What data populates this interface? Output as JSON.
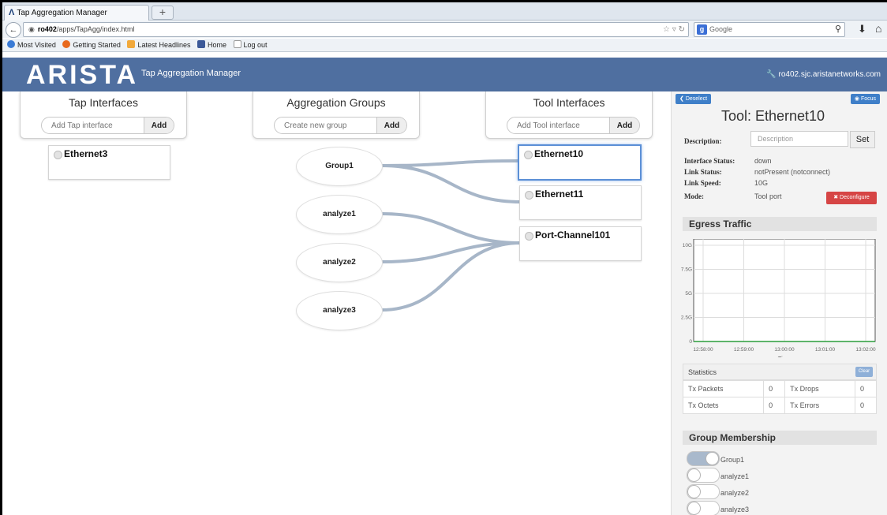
{
  "browser": {
    "tab_title": "Tap Aggregation Manager",
    "new_tab": "+",
    "url_host": "ro402",
    "url_path": "/apps/TapAgg/index.html",
    "search_placeholder": "Google",
    "bookmarks": [
      "Most Visited",
      "Getting Started",
      "Latest Headlines",
      "Home",
      "Log out"
    ]
  },
  "header": {
    "brand": "ARISTA",
    "app_title": "Tap Aggregation Manager",
    "host": "ro402.sjc.aristanetworks.com"
  },
  "columns": {
    "tap": {
      "title": "Tap Interfaces",
      "placeholder": "Add Tap interface",
      "add": "Add"
    },
    "groups": {
      "title": "Aggregation Groups",
      "placeholder": "Create new group",
      "add": "Add"
    },
    "tool": {
      "title": "Tool Interfaces",
      "placeholder": "Add Tool interface",
      "add": "Add"
    }
  },
  "tap_interfaces": [
    "Ethernet3"
  ],
  "groups": [
    "Group1",
    "analyze1",
    "analyze2",
    "analyze3"
  ],
  "tool_interfaces": [
    "Ethernet10",
    "Ethernet11",
    "Port-Channel101"
  ],
  "connections": [
    [
      "Group1",
      "Ethernet10"
    ],
    [
      "Group1",
      "Ethernet11"
    ],
    [
      "analyze1",
      "Port-Channel101"
    ],
    [
      "analyze2",
      "Port-Channel101"
    ],
    [
      "analyze3",
      "Port-Channel101"
    ]
  ],
  "panel": {
    "deselect": "Deselect",
    "focus": "Focus",
    "title": "Tool: Ethernet10",
    "description_label": "Description:",
    "description_placeholder": "Description",
    "set": "Set",
    "interface_status_label": "Interface Status:",
    "interface_status": "down",
    "link_status_label": "Link Status:",
    "link_status": "notPresent (notconnect)",
    "link_speed_label": "Link Speed:",
    "link_speed": "10G",
    "mode_label": "Mode:",
    "mode": "Tool port",
    "deconfigure": "Deconfigure",
    "egress_title": "Egress Traffic",
    "statistics_title": "Statistics",
    "clear": "Clear",
    "stats": [
      {
        "label": "Tx Packets",
        "value": "0",
        "label2": "Tx Drops",
        "value2": "0"
      },
      {
        "label": "Tx Octets",
        "value": "0",
        "label2": "Tx Errors",
        "value2": "0"
      }
    ],
    "membership_title": "Group Membership",
    "membership": [
      {
        "name": "Group1",
        "on": true
      },
      {
        "name": "analyze1",
        "on": false
      },
      {
        "name": "analyze2",
        "on": false
      },
      {
        "name": "analyze3",
        "on": false
      }
    ]
  },
  "chart_data": {
    "type": "line",
    "title": "",
    "xlabel": "Time",
    "ylabel": "",
    "x_ticks": [
      "12:58:00",
      "12:59:00",
      "13:00:00",
      "13:01:00",
      "13:02:00"
    ],
    "y_ticks": [
      "0",
      "2.5G",
      "5G",
      "7.5G",
      "10G"
    ],
    "ylim": [
      0,
      10
    ],
    "series": [
      {
        "values": [
          0,
          0,
          0,
          0,
          0
        ],
        "color": "#2a9d3a"
      }
    ],
    "grid": true
  }
}
